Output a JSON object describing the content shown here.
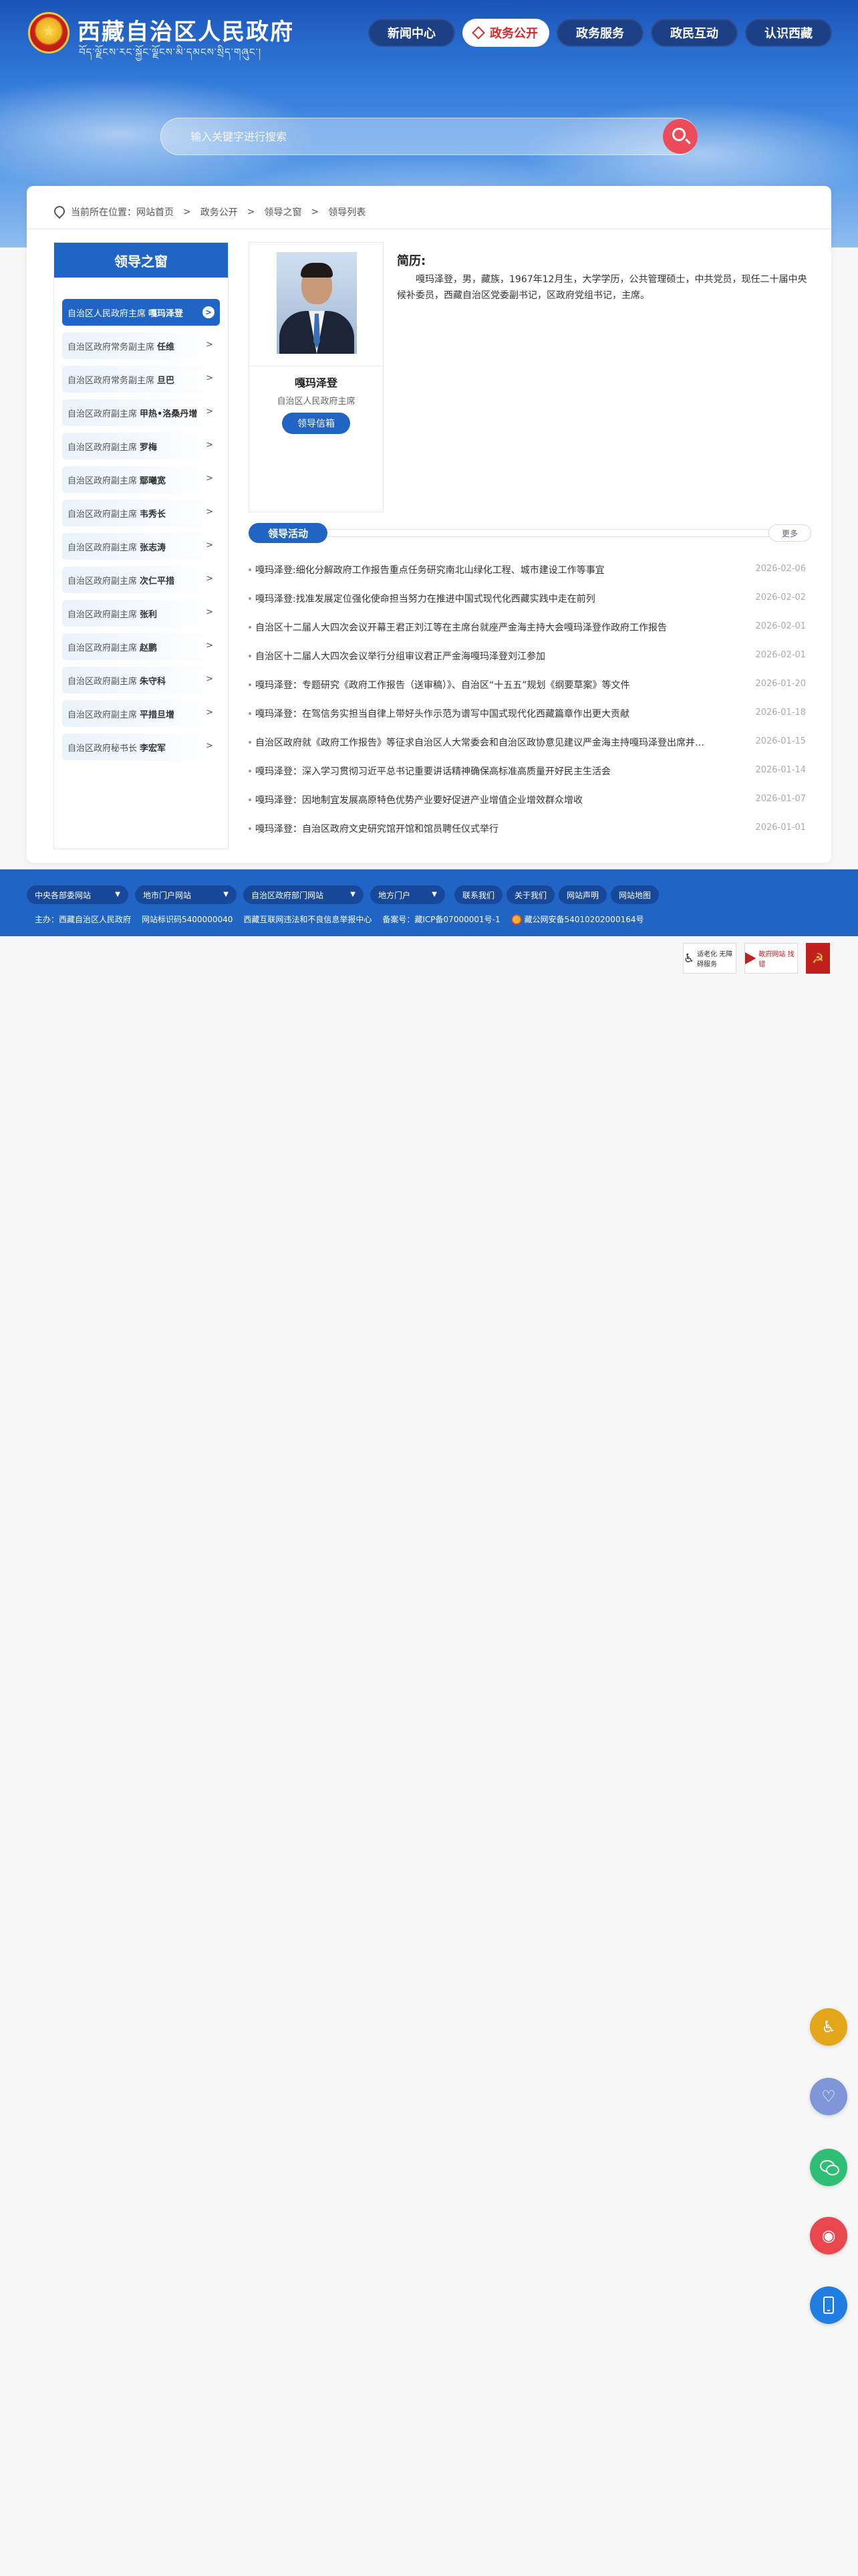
{
  "header": {
    "site_title": "西藏自治区人民政府",
    "site_subtitle": "བོད་ལྗོངས་རང་སྐྱོང་ལྗོངས་མི་དམངས་སྲིད་གཞུང་།",
    "nav": [
      {
        "label": "新闻中心",
        "active": false
      },
      {
        "label": "政务公开",
        "active": true
      },
      {
        "label": "政务服务",
        "active": false
      },
      {
        "label": "政民互动",
        "active": false
      },
      {
        "label": "认识西藏",
        "active": false
      }
    ],
    "search_placeholder": "输入关键字进行搜索"
  },
  "breadcrumb": {
    "prefix": "当前所在位置：",
    "items": [
      "网站首页",
      "政务公开",
      "领导之窗",
      "领导列表"
    ],
    "separator": ">"
  },
  "sidebar": {
    "title": "领导之窗",
    "items": [
      {
        "role": "自治区人民政府主席",
        "name": "嘎玛泽登",
        "active": true
      },
      {
        "role": "自治区政府常务副主席",
        "name": "任维",
        "active": false
      },
      {
        "role": "自治区政府常务副主席",
        "name": "旦巴",
        "active": false
      },
      {
        "role": "自治区政府副主席",
        "name": "甲热•洛桑丹增",
        "active": false
      },
      {
        "role": "自治区政府副主席",
        "name": "罗梅",
        "active": false
      },
      {
        "role": "自治区政府副主席",
        "name": "鄢曦宽",
        "active": false
      },
      {
        "role": "自治区政府副主席",
        "name": "韦秀长",
        "active": false
      },
      {
        "role": "自治区政府副主席",
        "name": "张志涛",
        "active": false
      },
      {
        "role": "自治区政府副主席",
        "name": "次仁平措",
        "active": false
      },
      {
        "role": "自治区政府副主席",
        "name": "张利",
        "active": false
      },
      {
        "role": "自治区政府副主席",
        "name": "赵鹏",
        "active": false
      },
      {
        "role": "自治区政府副主席",
        "name": "朱守科",
        "active": false
      },
      {
        "role": "自治区政府副主席",
        "name": "平措旦增",
        "active": false
      },
      {
        "role": "自治区政府秘书长",
        "name": "李宏军",
        "active": false
      }
    ],
    "arrow": ">"
  },
  "profile": {
    "name": "嘎玛泽登",
    "title": "自治区人民政府主席",
    "mailbox_label": "领导信箱",
    "bio_heading": "简历:",
    "bio": "嘎玛泽登，男，藏族，1967年12月生，大学学历，公共管理硕士，中共党员，现任二十届中央候补委员，西藏自治区党委副书记，区政府党组书记，主席。"
  },
  "activities": {
    "tab_label": "领导活动",
    "more_label": "更多",
    "items": [
      {
        "title": "嘎玛泽登:细化分解政府工作报告重点任务研究南北山绿化工程、城市建设工作等事宜",
        "date": "2026-02-06"
      },
      {
        "title": "嘎玛泽登:找准发展定位强化使命担当努力在推进中国式现代化西藏实践中走在前列",
        "date": "2026-02-02"
      },
      {
        "title": "自治区十二届人大四次会议开幕王君正刘江等在主席台就座严金海主持大会嘎玛泽登作政府工作报告",
        "date": "2026-02-01"
      },
      {
        "title": "自治区十二届人大四次会议举行分组审议君正严金海嘎玛泽登刘江参加",
        "date": "2026-02-01"
      },
      {
        "title": "嘎玛泽登：专题研究《政府工作报告（送审稿）》、自治区“十五五”规划《纲要草案》等文件",
        "date": "2026-01-20"
      },
      {
        "title": "嘎玛泽登：在驾信务实担当自律上带好头作示范为谱写中国式现代化西藏篇章作出更大贡献",
        "date": "2026-01-18"
      },
      {
        "title": "自治区政府就《政府工作报告》等征求自治区人大常委会和自治区政协意见建议严金海主持嘎玛泽登出席并讲话",
        "date": "2026-01-15"
      },
      {
        "title": "嘎玛泽登：深入学习贯彻习近平总书记重要讲话精神确保高标准高质量开好民主生活会",
        "date": "2026-01-14"
      },
      {
        "title": "嘎玛泽登：因地制宜发展高原特色优势产业要好促进产业增值企业增效群众增收",
        "date": "2026-01-07"
      },
      {
        "title": "嘎玛泽登：自治区政府文史研究馆开馆和馆员聘任仪式举行",
        "date": "2026-01-01"
      }
    ]
  },
  "footer": {
    "selects": [
      "中央各部委网站",
      "地市门户网站",
      "自治区政府部门网站",
      "地方门户"
    ],
    "links": [
      "联系我们",
      "关于我们",
      "网站声明",
      "网站地图"
    ],
    "info": [
      "主办：西藏自治区人民政府",
      "网站标识码5400000040",
      "西藏互联网违法和不良信息举报中心",
      "备案号：藏ICP备07000001号-1",
      "藏公网安备54010202000164号"
    ]
  },
  "badges": {
    "accessible": "适老化 无障碍服务",
    "gov": "政府网站 找错"
  }
}
